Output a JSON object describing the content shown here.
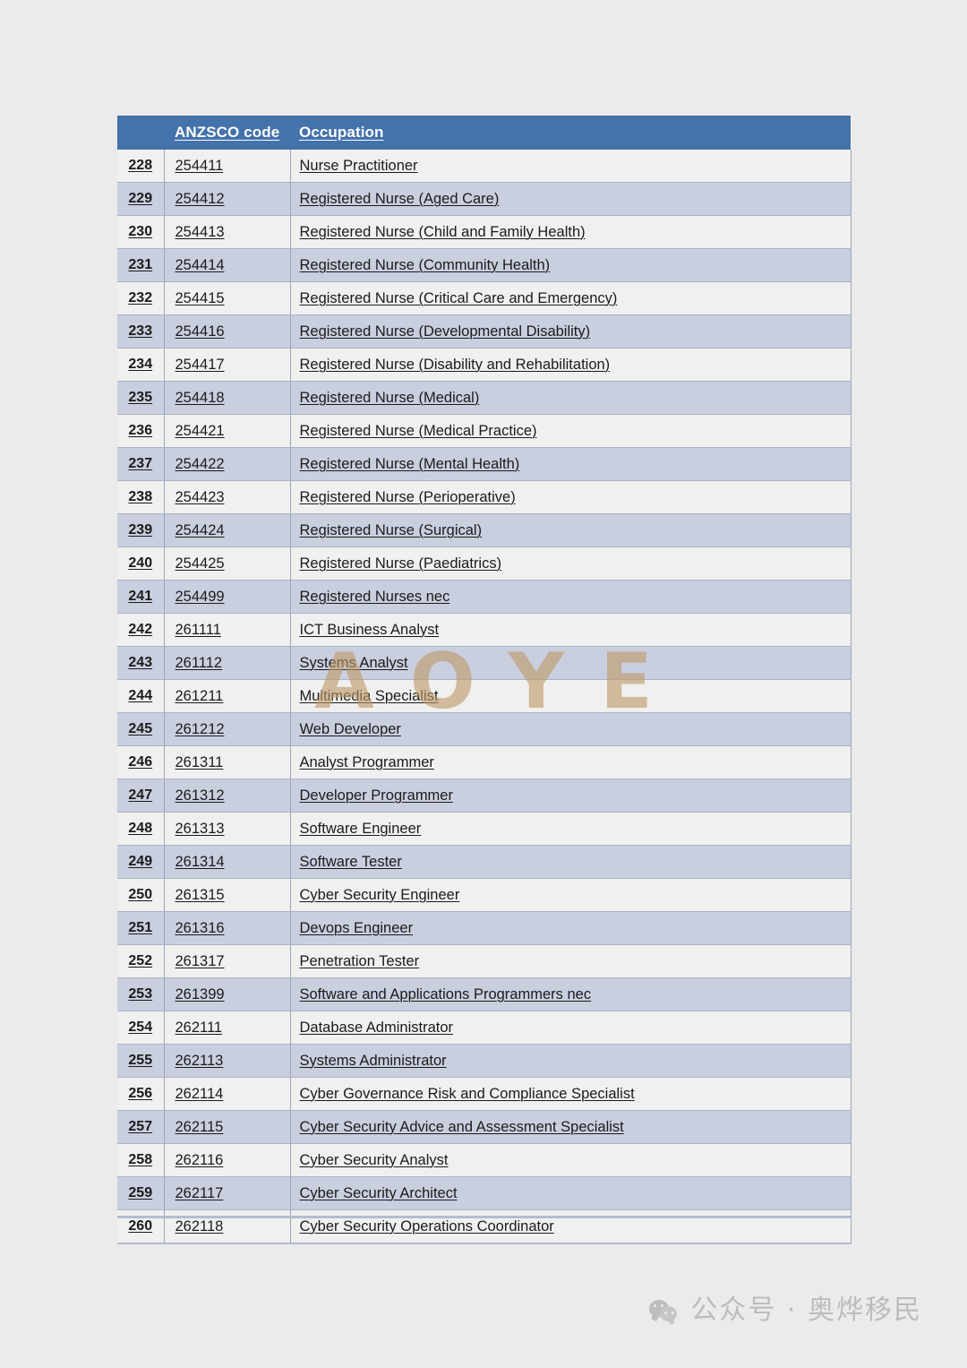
{
  "page": {
    "background_color": "#ebebeb",
    "watermark_text": "AOYE",
    "watermark_color": "#be9868"
  },
  "table": {
    "header_background": "#4472ab",
    "header_text_color": "#ffffff",
    "alt_row_color": "#c9cfdf",
    "base_row_color": "#f0f0ee",
    "columns": [
      "",
      "ANZSCO code",
      "Occupation"
    ],
    "rows": [
      {
        "num": "228",
        "code": "254411",
        "occupation": "Nurse Practitioner"
      },
      {
        "num": "229",
        "code": "254412",
        "occupation": "Registered Nurse (Aged Care)"
      },
      {
        "num": "230",
        "code": "254413",
        "occupation": "Registered Nurse (Child and Family Health)"
      },
      {
        "num": "231",
        "code": "254414",
        "occupation": "Registered Nurse (Community Health)"
      },
      {
        "num": "232",
        "code": "254415",
        "occupation": "Registered Nurse (Critical Care and Emergency)"
      },
      {
        "num": "233",
        "code": "254416",
        "occupation": "Registered Nurse (Developmental Disability)"
      },
      {
        "num": "234",
        "code": "254417",
        "occupation": "Registered Nurse (Disability and Rehabilitation)"
      },
      {
        "num": "235",
        "code": "254418",
        "occupation": "Registered Nurse (Medical)"
      },
      {
        "num": "236",
        "code": "254421",
        "occupation": "Registered Nurse (Medical Practice)"
      },
      {
        "num": "237",
        "code": "254422",
        "occupation": "Registered Nurse (Mental Health)"
      },
      {
        "num": "238",
        "code": "254423",
        "occupation": "Registered Nurse (Perioperative)"
      },
      {
        "num": "239",
        "code": "254424",
        "occupation": "Registered Nurse (Surgical)"
      },
      {
        "num": "240",
        "code": "254425",
        "occupation": "Registered Nurse (Paediatrics)"
      },
      {
        "num": "241",
        "code": "254499",
        "occupation": "Registered Nurses nec"
      },
      {
        "num": "242",
        "code": "261111",
        "occupation": "ICT Business Analyst"
      },
      {
        "num": "243",
        "code": "261112",
        "occupation": "Systems Analyst"
      },
      {
        "num": "244",
        "code": "261211",
        "occupation": "Multimedia Specialist"
      },
      {
        "num": "245",
        "code": "261212",
        "occupation": "Web Developer"
      },
      {
        "num": "246",
        "code": "261311",
        "occupation": "Analyst Programmer"
      },
      {
        "num": "247",
        "code": "261312",
        "occupation": "Developer Programmer"
      },
      {
        "num": "248",
        "code": "261313",
        "occupation": "Software Engineer"
      },
      {
        "num": "249",
        "code": "261314",
        "occupation": "Software Tester"
      },
      {
        "num": "250",
        "code": "261315",
        "occupation": "Cyber Security Engineer"
      },
      {
        "num": "251",
        "code": "261316",
        "occupation": "Devops Engineer"
      },
      {
        "num": "252",
        "code": "261317",
        "occupation": "Penetration Tester"
      },
      {
        "num": "253",
        "code": "261399",
        "occupation": "Software and Applications Programmers nec"
      },
      {
        "num": "254",
        "code": "262111",
        "occupation": "Database Administrator"
      },
      {
        "num": "255",
        "code": "262113",
        "occupation": "Systems Administrator"
      },
      {
        "num": "256",
        "code": "262114",
        "occupation": "Cyber Governance Risk and Compliance Specialist"
      },
      {
        "num": "257",
        "code": "262115",
        "occupation": "Cyber Security Advice and Assessment Specialist"
      },
      {
        "num": "258",
        "code": "262116",
        "occupation": "Cyber Security Analyst"
      },
      {
        "num": "259",
        "code": "262117",
        "occupation": "Cyber Security Architect"
      },
      {
        "num": "260",
        "code": "262118",
        "occupation": "Cyber Security Operations Coordinator"
      }
    ]
  },
  "footer": {
    "icon": "wechat-icon",
    "text": "公众号 · 奥烨移民",
    "text_color": "#bcbcbc"
  }
}
